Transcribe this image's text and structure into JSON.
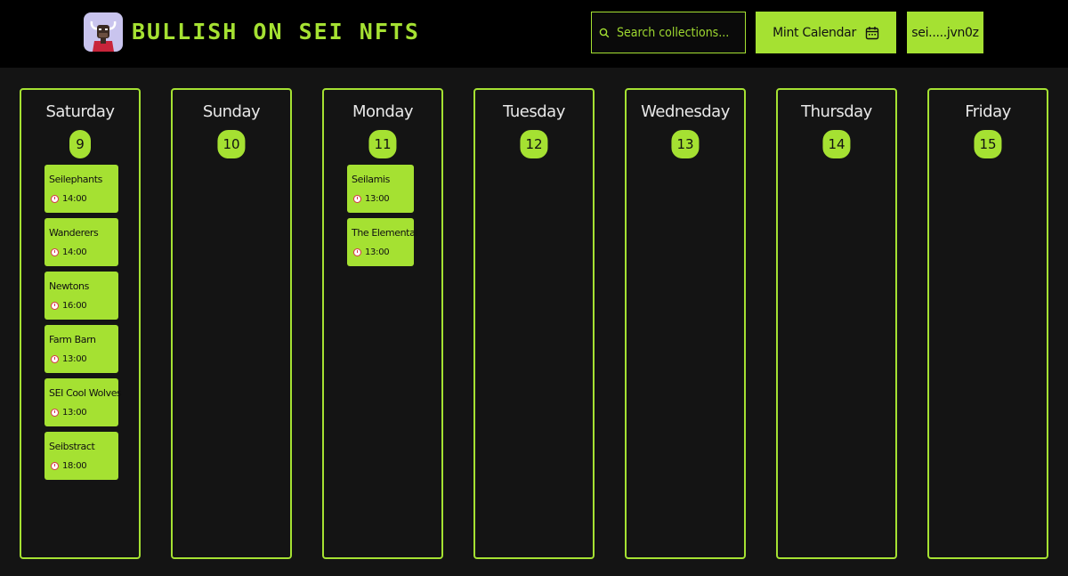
{
  "header": {
    "title": "BULLISH ON SEI NFTS",
    "search_placeholder": "Search collections...",
    "mint_calendar_label": "Mint Calendar",
    "wallet_label": "sei.....jvn0z"
  },
  "calendar": {
    "days": [
      {
        "day": "Saturday",
        "date": "9",
        "events": [
          {
            "name": "Seilephants",
            "time": "14:00"
          },
          {
            "name": "Wanderers",
            "time": "14:00"
          },
          {
            "name": "Newtons",
            "time": "16:00"
          },
          {
            "name": "Farm Barn",
            "time": "13:00"
          },
          {
            "name": "SEI Cool Wolves",
            "time": "13:00"
          },
          {
            "name": "Seibstract",
            "time": "18:00"
          }
        ]
      },
      {
        "day": "Sunday",
        "date": "10",
        "events": []
      },
      {
        "day": "Monday",
        "date": "11",
        "events": [
          {
            "name": "Seilamis",
            "time": "13:00"
          },
          {
            "name": "The Elemental",
            "time": "13:00"
          }
        ]
      },
      {
        "day": "Tuesday",
        "date": "12",
        "events": []
      },
      {
        "day": "Wednesday",
        "date": "13",
        "events": []
      },
      {
        "day": "Thursday",
        "date": "14",
        "events": []
      },
      {
        "day": "Friday",
        "date": "15",
        "events": []
      }
    ]
  },
  "colors": {
    "accent": "#a5e132",
    "background": "#141414",
    "header_background": "#000000",
    "clock_icon": "#d8344a"
  },
  "icons": {
    "search": "search-icon",
    "calendar": "calendar-icon",
    "event_time": "clock-icon",
    "logo": "bull-avatar-logo"
  }
}
